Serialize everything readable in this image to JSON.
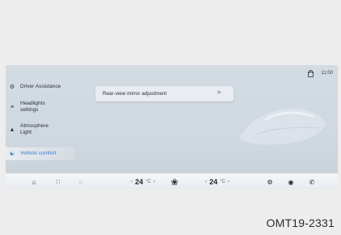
{
  "status": {
    "clock": "11:00",
    "icon": "lock-icon"
  },
  "sidebar": {
    "items": [
      {
        "label": "Driver Assistance",
        "icon": "steering-wheel-icon",
        "active": false
      },
      {
        "label": "Headlights settings",
        "icon": "headlight-icon",
        "active": false
      },
      {
        "label": "Atmosphere Light",
        "icon": "ambient-light-icon",
        "active": false
      },
      {
        "label": "Vehicle comfort",
        "icon": "car-comfort-icon",
        "active": true
      }
    ]
  },
  "content": {
    "card_label": "Rear-view mirror adjustment",
    "card_chevron": ">"
  },
  "bottom_bar": {
    "home_icon": "home-icon",
    "apps_icon": "grid-icon",
    "car_icon": "car-icon",
    "left_temp": {
      "prev": "‹",
      "value": "24",
      "unit": "°C",
      "next": "›"
    },
    "fan_icon": "fan-icon",
    "right_temp": {
      "prev": "‹",
      "value": "24",
      "unit": "°C",
      "next": "›"
    },
    "settings_icon": "gear-icon",
    "media_icon": "music-icon",
    "phone_icon": "phone-icon"
  },
  "figure_code": "OMT19-2331",
  "colors": {
    "accent": "#2f7fd4",
    "screen_bg": "#d3dbe3",
    "page_bg": "#ededed"
  }
}
